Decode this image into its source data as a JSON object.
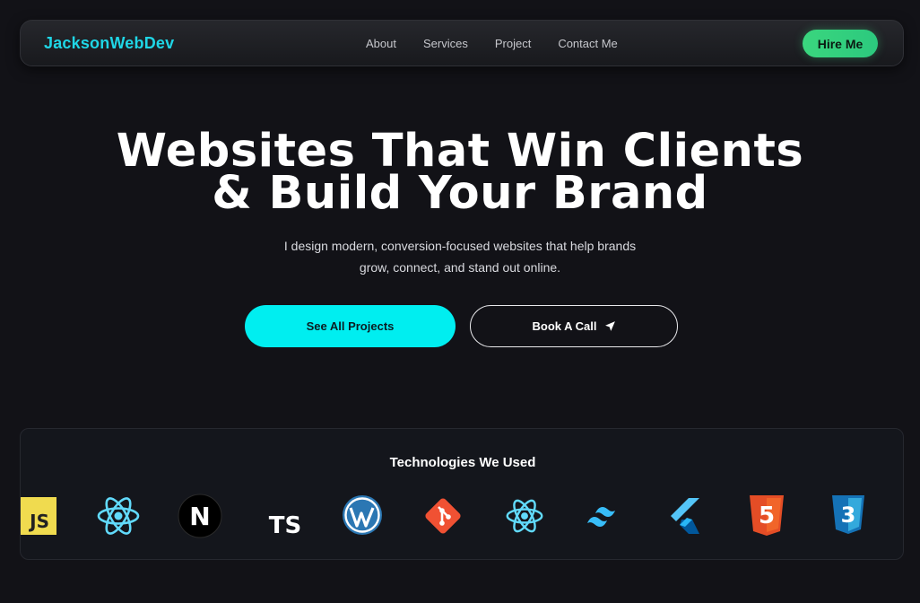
{
  "nav": {
    "brand": "JacksonWebDev",
    "links": [
      "About",
      "Services",
      "Project",
      "Contact Me"
    ],
    "cta_label": "Hire Me"
  },
  "hero": {
    "title_lines": [
      "Websites That Win Clients",
      "& Build Your Brand"
    ],
    "subtitle_lines": [
      "I design modern, conversion-focused websites that help brands",
      "grow, connect, and stand out online."
    ],
    "primary_button": "See All Projects",
    "secondary_button": "Book A Call",
    "secondary_button_icon": "send-arrow-icon"
  },
  "tech": {
    "title": "Technologies We Used",
    "icons": [
      {
        "name": "javascript-icon",
        "text": "JS"
      },
      {
        "name": "react-icon"
      },
      {
        "name": "nextjs-icon",
        "text": "N"
      },
      {
        "name": "typescript-icon",
        "text": "TS"
      },
      {
        "name": "wordpress-icon"
      },
      {
        "name": "git-icon"
      },
      {
        "name": "react-icon"
      },
      {
        "name": "tailwind-icon"
      },
      {
        "name": "flutter-icon"
      },
      {
        "name": "html5-icon",
        "text": "5"
      },
      {
        "name": "css3-icon",
        "text": "3"
      }
    ]
  },
  "colors": {
    "background": "#121217",
    "brand": "#1fd6e6",
    "hire_button": "#3ad67e",
    "primary_button": "#00eef0"
  }
}
